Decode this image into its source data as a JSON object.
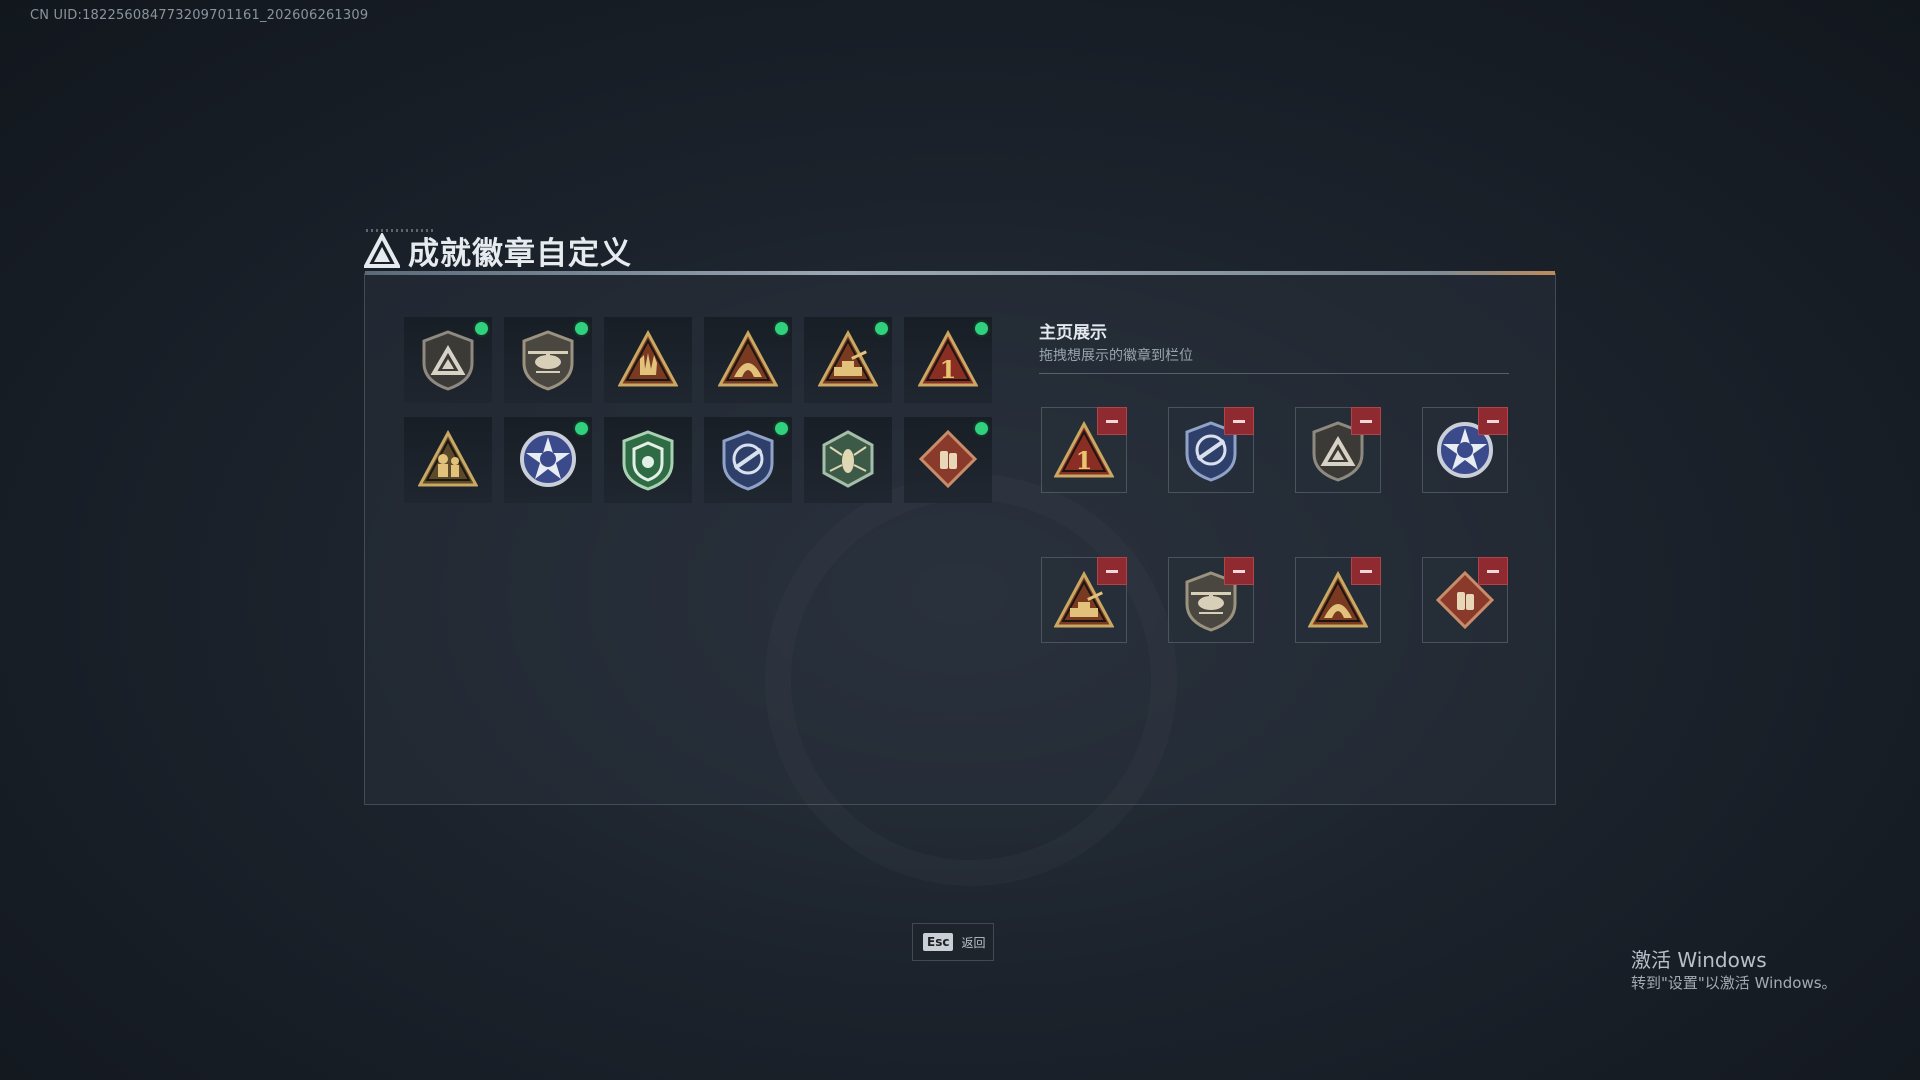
{
  "uid_text": "CN UID:182256084773209701161_202606261309",
  "title": "成就徽章自定义",
  "owned_badges": [
    {
      "name": "shield-triangle-badge",
      "new": true
    },
    {
      "name": "helicopter-badge",
      "new": true
    },
    {
      "name": "hand-triangle-badge",
      "new": false
    },
    {
      "name": "flame-triangle-badge",
      "new": true
    },
    {
      "name": "tank-triangle-badge",
      "new": true
    },
    {
      "name": "number-one-badge",
      "new": true
    },
    {
      "name": "soldier-triangle-badge",
      "new": false
    },
    {
      "name": "star-emblem-badge",
      "new": true
    },
    {
      "name": "green-shield-badge",
      "new": false
    },
    {
      "name": "rocket-shield-badge",
      "new": true
    },
    {
      "name": "hexagon-insect-badge",
      "new": false
    },
    {
      "name": "diamond-pack-badge",
      "new": true
    }
  ],
  "display": {
    "title": "主页展示",
    "subtitle": "拖拽想展示的徽章到栏位",
    "slots": [
      "number-one-badge",
      "rocket-shield-badge",
      "shield-triangle-badge",
      "star-emblem-badge",
      "tank-triangle-badge",
      "helicopter-badge",
      "flame-triangle-badge",
      "diamond-pack-badge"
    ]
  },
  "esc": {
    "key": "Esc",
    "label": "返回"
  },
  "windows": {
    "line1": "激活 Windows",
    "line2": "转到\"设置\"以激活 Windows。"
  },
  "colors": {
    "new_dot": "#2fd17e",
    "remove": "#8e2a30",
    "gold": "#c9a862"
  }
}
